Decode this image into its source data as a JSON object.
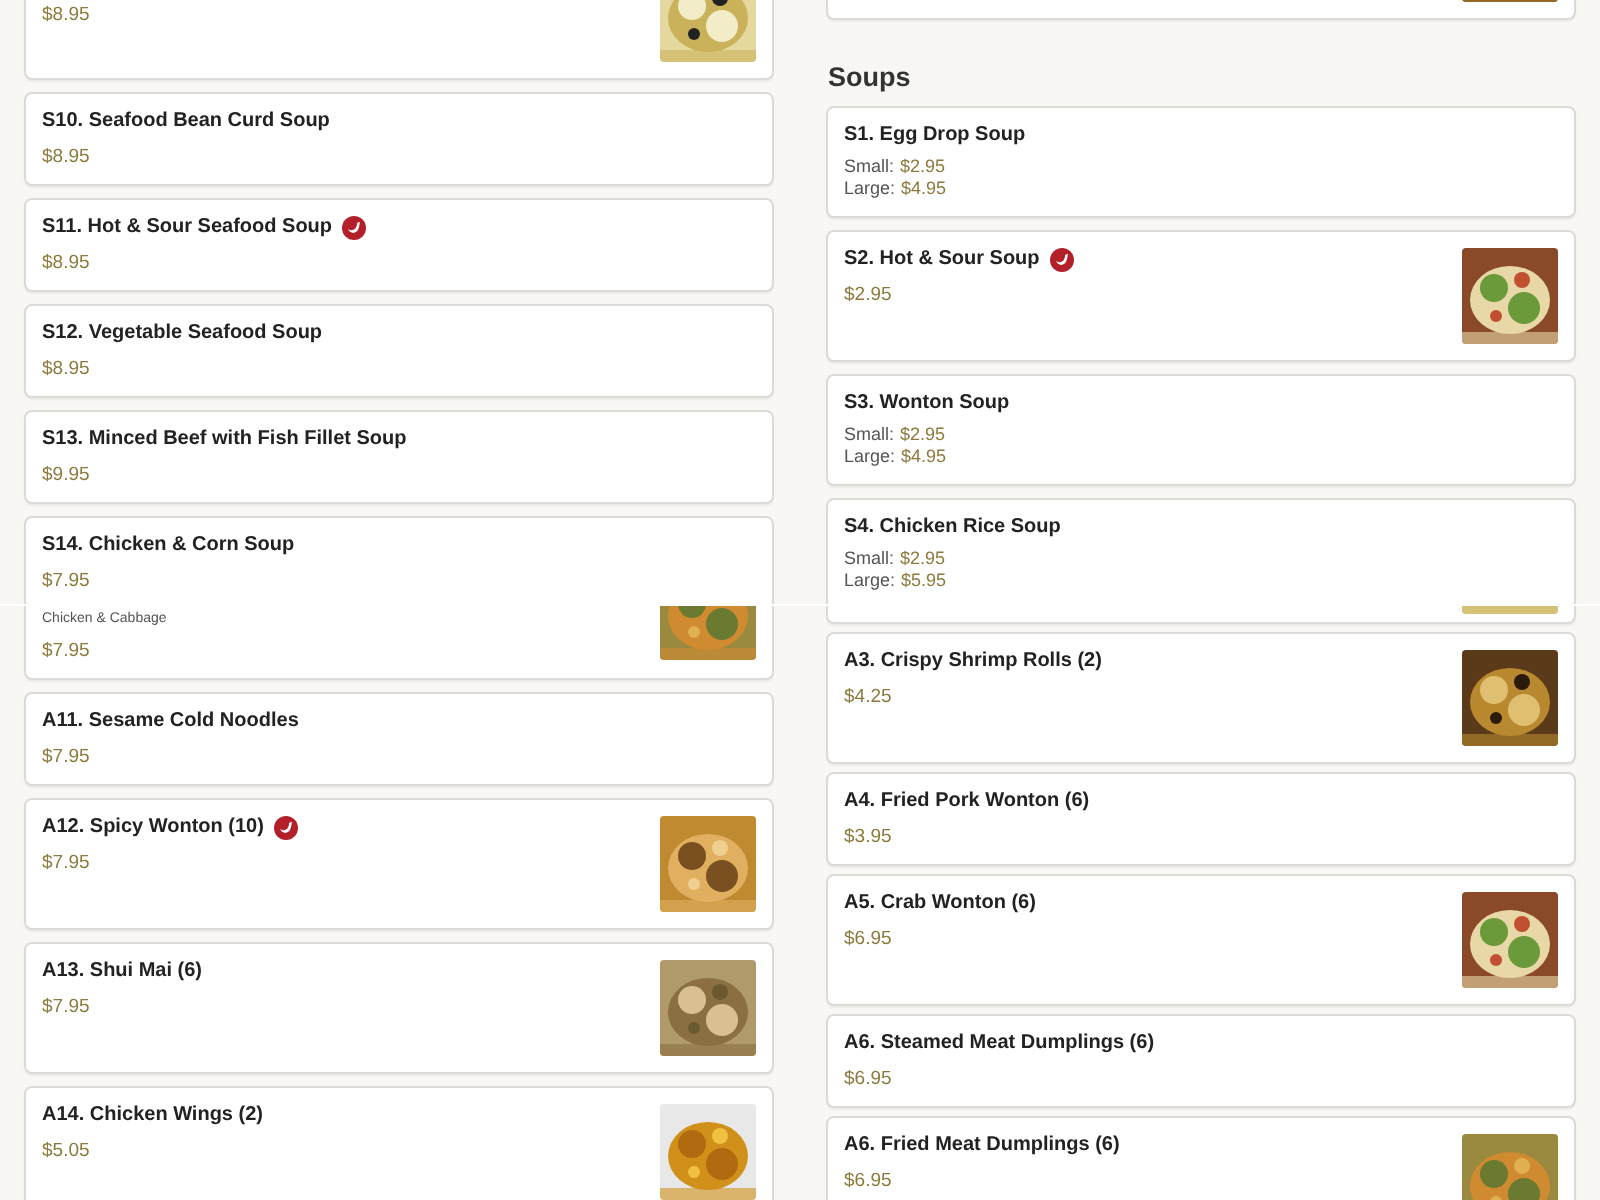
{
  "strips": [
    {
      "columns": [
        {
          "items": [
            {
              "kind": "partial",
              "price": "$8.95",
              "photo": true
            },
            {
              "kind": "card",
              "name": "S10. Seafood Bean Curd Soup",
              "price": "$8.95",
              "spicy": false,
              "photo": false
            },
            {
              "kind": "card",
              "name": "S11. Hot & Sour Seafood Soup",
              "price": "$8.95",
              "spicy": true,
              "photo": false
            },
            {
              "kind": "card",
              "name": "S12. Vegetable Seafood Soup",
              "price": "$8.95",
              "spicy": false,
              "photo": false
            },
            {
              "kind": "card",
              "name": "S13. Minced Beef with Fish Fillet Soup",
              "price": "$9.95",
              "spicy": false,
              "photo": false
            },
            {
              "kind": "card",
              "name": "S14. Chicken & Corn Soup",
              "price": "$7.95",
              "spicy": false,
              "photo": false
            }
          ]
        },
        {
          "items": [
            {
              "kind": "partial",
              "photo": true
            },
            {
              "kind": "heading",
              "text": "Soups"
            },
            {
              "kind": "card",
              "name": "S1. Egg Drop Soup",
              "sizes": [
                {
                  "label": "Small:",
                  "price": "$2.95"
                },
                {
                  "label": "Large:",
                  "price": "$4.95"
                }
              ],
              "spicy": false,
              "photo": false
            },
            {
              "kind": "card",
              "name": "S2. Hot & Sour Soup",
              "price": "$2.95",
              "spicy": true,
              "photo": true
            },
            {
              "kind": "card",
              "name": "S3. Wonton Soup",
              "sizes": [
                {
                  "label": "Small:",
                  "price": "$2.95"
                },
                {
                  "label": "Large:",
                  "price": "$4.95"
                }
              ],
              "spicy": false,
              "photo": false
            },
            {
              "kind": "card",
              "name": "S4. Chicken Rice Soup",
              "sizes": [
                {
                  "label": "Small:",
                  "price": "$2.95"
                },
                {
                  "label": "Large:",
                  "price": "$5.95"
                }
              ],
              "spicy": false,
              "photo": false
            }
          ]
        }
      ]
    },
    {
      "columns": [
        {
          "items": [
            {
              "kind": "partial",
              "description": "Chicken & Cabbage",
              "price": "$7.95",
              "photo": true
            },
            {
              "kind": "card",
              "name": "A11. Sesame Cold Noodles",
              "price": "$7.95",
              "spicy": false,
              "photo": false
            },
            {
              "kind": "card",
              "name": "A12. Spicy Wonton (10)",
              "price": "$7.95",
              "spicy": true,
              "photo": true
            },
            {
              "kind": "card",
              "name": "A13. Shui Mai (6)",
              "price": "$7.95",
              "spicy": false,
              "photo": true
            },
            {
              "kind": "card",
              "name": "A14. Chicken Wings (2)",
              "price": "$5.05",
              "spicy": false,
              "photo": true
            }
          ]
        },
        {
          "items": [
            {
              "kind": "partial",
              "photo": true
            },
            {
              "kind": "card",
              "name": "A3. Crispy Shrimp Rolls (2)",
              "price": "$4.25",
              "spicy": false,
              "photo": true
            },
            {
              "kind": "card",
              "name": "A4. Fried Pork Wonton (6)",
              "price": "$3.95",
              "spicy": false,
              "photo": false
            },
            {
              "kind": "card",
              "name": "A5. Crab Wonton (6)",
              "price": "$6.95",
              "spicy": false,
              "photo": true
            },
            {
              "kind": "card",
              "name": "A6. Steamed Meat Dumplings (6)",
              "price": "$6.95",
              "spicy": false,
              "photo": false
            },
            {
              "kind": "card",
              "name": "A6. Fried Meat Dumplings (6)",
              "price": "$6.95",
              "spicy": false,
              "photo": true
            }
          ]
        }
      ]
    }
  ]
}
